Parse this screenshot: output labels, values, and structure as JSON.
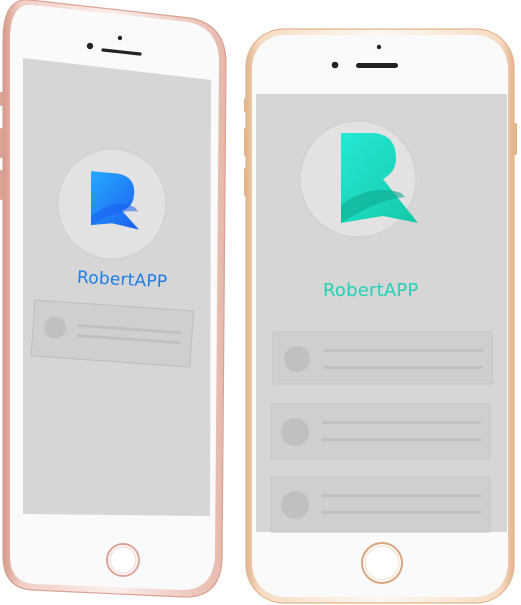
{
  "colors": {
    "page_background": "#ffffff",
    "screen_background": "#d6d6d6",
    "card_background": "#cfcfcf",
    "logo_circle": "#e2e2e2",
    "rose_gold_frame": "#e8bdb2",
    "gold_frame": "#e9c6a3",
    "blue_logo": [
      "#1a5ef0",
      "#27a8ff"
    ],
    "teal_logo": [
      "#13c9a8",
      "#25e8d6"
    ],
    "blue_text": "#1c7ee8",
    "teal_text": "#20d3b8"
  },
  "phones": {
    "left": {
      "frame_finish": "rose gold",
      "app_name": "RobertAPP",
      "logo_icon": "r-letter-icon",
      "cards": 1
    },
    "right": {
      "frame_finish": "gold",
      "app_name": "RobertAPP",
      "logo_icon": "r-letter-icon",
      "cards": 3
    }
  }
}
